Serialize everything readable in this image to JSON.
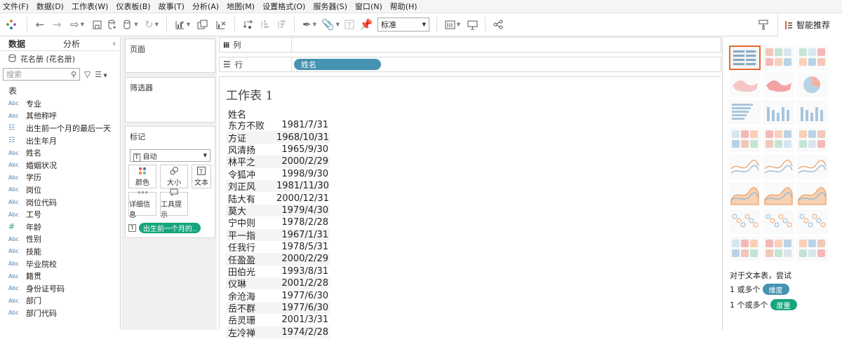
{
  "menu": [
    "文件(F)",
    "数据(D)",
    "工作表(W)",
    "仪表板(B)",
    "故事(T)",
    "分析(A)",
    "地图(M)",
    "设置格式(O)",
    "服务器(S)",
    "窗口(N)",
    "帮助(H)"
  ],
  "toolbar": {
    "fit_select": "标准",
    "smart_recommend": "智能推荐"
  },
  "left_pane": {
    "tab_data": "数据",
    "tab_analysis": "分析",
    "datasource": "花名册 (花名册)",
    "search_placeholder": "搜索",
    "tables_heading": "表",
    "fields": [
      {
        "type": "Abc",
        "name": "专业"
      },
      {
        "type": "Abc",
        "name": "其他称呼"
      },
      {
        "type": "date",
        "name": "出生前一个月的最后一天"
      },
      {
        "type": "date",
        "name": "出生年月"
      },
      {
        "type": "Abc",
        "name": "姓名"
      },
      {
        "type": "Abc",
        "name": "婚姻状况"
      },
      {
        "type": "Abc",
        "name": "学历"
      },
      {
        "type": "Abc",
        "name": "岗位"
      },
      {
        "type": "Abc",
        "name": "岗位代码"
      },
      {
        "type": "Abc",
        "name": "工号"
      },
      {
        "type": "#",
        "name": "年龄"
      },
      {
        "type": "Abc",
        "name": "性别"
      },
      {
        "type": "Abc",
        "name": "技能"
      },
      {
        "type": "Abc",
        "name": "毕业院校"
      },
      {
        "type": "Abc",
        "name": "籍贯"
      },
      {
        "type": "Abc",
        "name": "身份证号码"
      },
      {
        "type": "Abc",
        "name": "部门"
      },
      {
        "type": "Abc",
        "name": "部门代码"
      }
    ]
  },
  "cards": {
    "pages": "页面",
    "filters": "筛选器",
    "marks": "标记",
    "mark_type": "自动",
    "btn_color": "颜色",
    "btn_size": "大小",
    "btn_text": "文本",
    "btn_detail": "详细信息",
    "btn_tooltip": "工具提示",
    "text_pill": "出生前一个月的.."
  },
  "shelves": {
    "columns_label": "列",
    "rows_label": "行",
    "rows_pill": "姓名"
  },
  "view": {
    "title": "工作表 1",
    "column_header": "姓名",
    "rows": [
      {
        "name": "东方不败",
        "value": "1981/7/31"
      },
      {
        "name": "方证",
        "value": "1968/10/31"
      },
      {
        "name": "风清扬",
        "value": "1965/9/30"
      },
      {
        "name": "林平之",
        "value": "2000/2/29"
      },
      {
        "name": "令狐冲",
        "value": "1998/9/30"
      },
      {
        "name": "刘正风",
        "value": "1981/11/30"
      },
      {
        "name": "陆大有",
        "value": "2000/12/31"
      },
      {
        "name": "莫大",
        "value": "1979/4/30"
      },
      {
        "name": "宁中则",
        "value": "1978/2/28"
      },
      {
        "name": "平一指",
        "value": "1967/1/31"
      },
      {
        "name": "任我行",
        "value": "1978/5/31"
      },
      {
        "name": "任盈盈",
        "value": "2000/2/29"
      },
      {
        "name": "田伯光",
        "value": "1993/8/31"
      },
      {
        "name": "仪琳",
        "value": "2001/2/28"
      },
      {
        "name": "余沧海",
        "value": "1977/6/30"
      },
      {
        "name": "岳不群",
        "value": "1977/6/30"
      },
      {
        "name": "岳灵珊",
        "value": "2001/3/31"
      },
      {
        "name": "左冷禅",
        "value": "1974/2/28"
      }
    ]
  },
  "show_me": {
    "hint_title": "对于文本表，尝试",
    "hint_dim_prefix": "1 或多个",
    "hint_dim_chip": "维度",
    "hint_measure_prefix": "1 个或多个",
    "hint_measure_chip": "度量",
    "tiles": [
      "text-table",
      "heat-map",
      "highlight-table",
      "symbol-map",
      "filled-map",
      "pie-chart",
      "horizontal-bars",
      "stacked-bars",
      "side-by-side-bars",
      "treemap",
      "circle-views",
      "side-by-side-circles",
      "line-continuous",
      "line-discrete",
      "dual-line",
      "area-continuous",
      "area-discrete",
      "dual-combination",
      "scatter-plot",
      "histogram",
      "box-and-whisker",
      "gantt-chart",
      "bullet-graph",
      "packed-bubbles"
    ],
    "colors": {
      "dimension_chip": "#4593b1",
      "measure_chip": "#18a57e",
      "selected_border": "#e4692c"
    }
  }
}
